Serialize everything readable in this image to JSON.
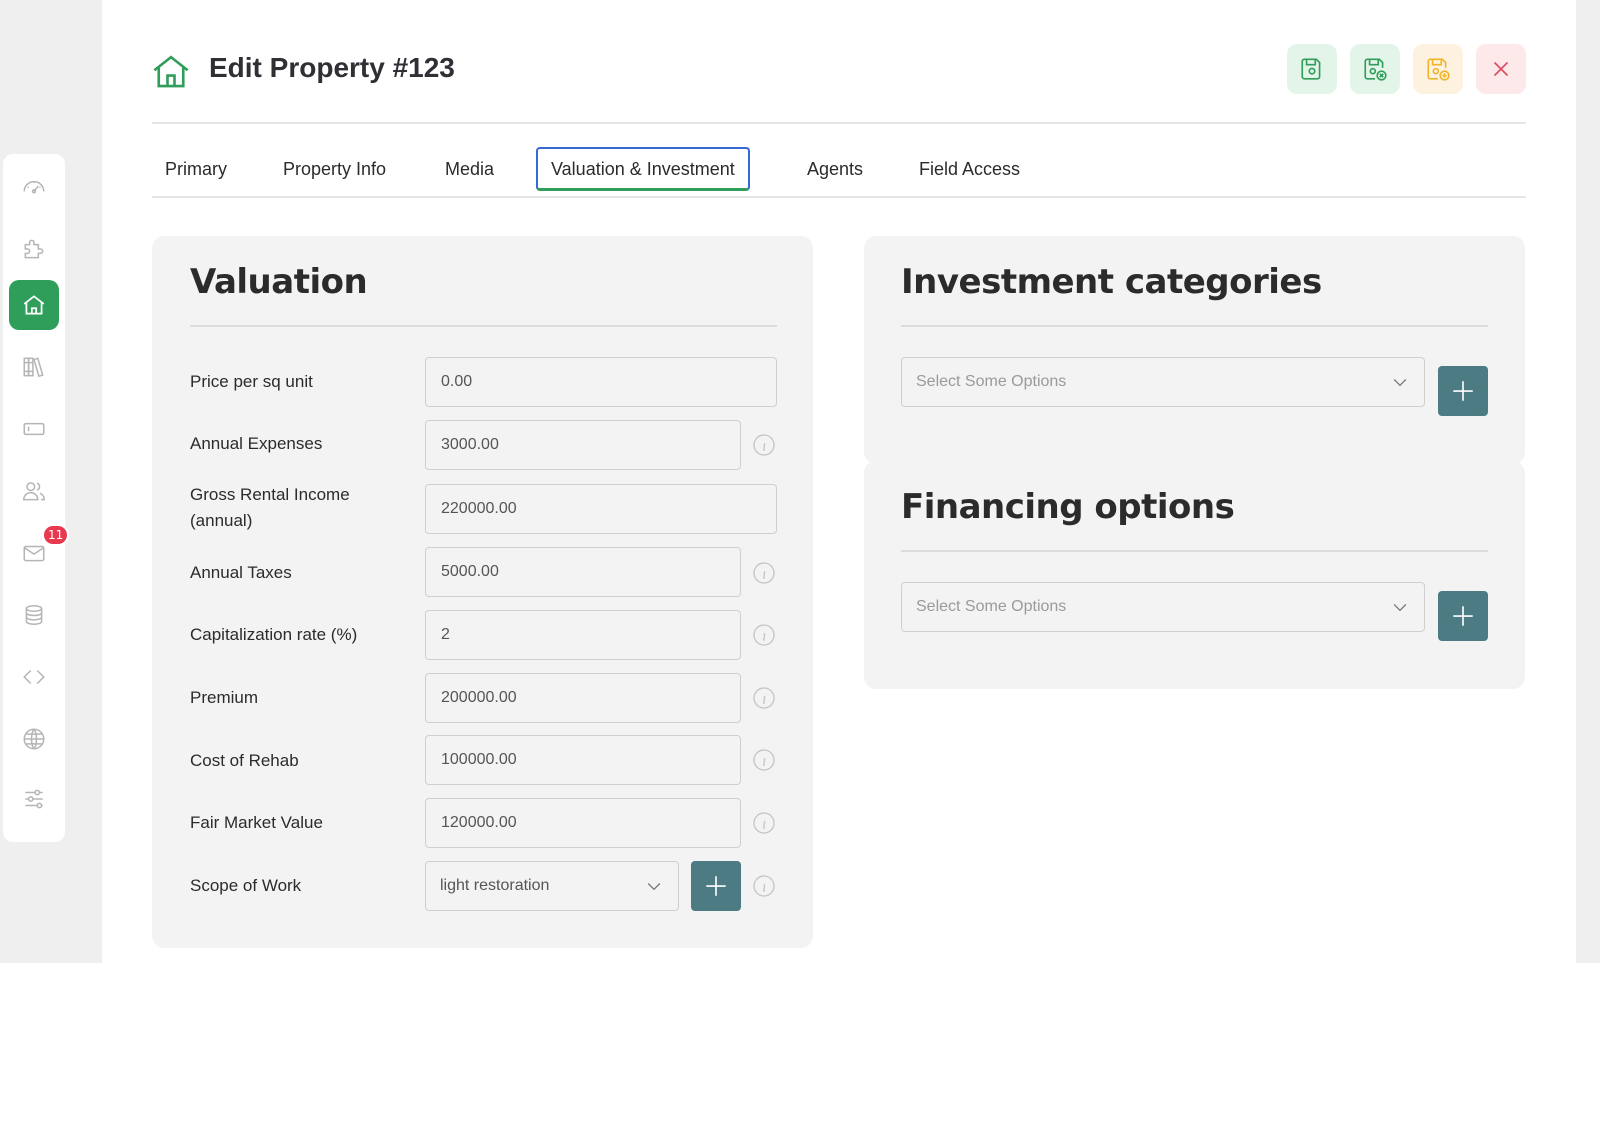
{
  "header": {
    "title": "Edit Property #123",
    "icon": "house-icon",
    "actions": [
      {
        "name": "save",
        "icon": "save-icon",
        "bg": "#e3f4e8",
        "color": "#2f9e5a"
      },
      {
        "name": "save-close",
        "icon": "save-close-icon",
        "bg": "#e3f4e8",
        "color": "#2f9e5a"
      },
      {
        "name": "save-new",
        "icon": "save-new-icon",
        "bg": "#fdf2e0",
        "color": "#f0b429"
      },
      {
        "name": "close",
        "icon": "close-icon",
        "bg": "#fde8ea",
        "color": "#e04a5e"
      }
    ]
  },
  "sidebar": {
    "items": [
      {
        "icon": "dashboard-icon"
      },
      {
        "icon": "puzzle-icon"
      },
      {
        "icon": "home-icon",
        "active": true
      },
      {
        "icon": "library-icon"
      },
      {
        "icon": "ticket-icon"
      },
      {
        "icon": "users-icon"
      },
      {
        "icon": "mail-icon",
        "badge": "11"
      },
      {
        "icon": "database-icon"
      },
      {
        "icon": "code-icon"
      },
      {
        "icon": "globe-icon"
      },
      {
        "icon": "sliders-icon"
      }
    ]
  },
  "tabs": [
    {
      "label": "Primary"
    },
    {
      "label": "Property Info"
    },
    {
      "label": "Media"
    },
    {
      "label": "Valuation & Investment",
      "active": true
    },
    {
      "label": "Agents"
    },
    {
      "label": "Field Access"
    }
  ],
  "valuation": {
    "title": "Valuation",
    "fields": [
      {
        "label": "Price per sq unit",
        "value": "0.00"
      },
      {
        "label": "Annual Expenses",
        "value": "3000.00"
      },
      {
        "label": "Gross Rental Income (annual)",
        "value": "220000.00"
      },
      {
        "label": "Annual Taxes",
        "value": "5000.00"
      },
      {
        "label": "Capitalization rate (%)",
        "value": "2"
      },
      {
        "label": "Premium",
        "value": "200000.00"
      },
      {
        "label": "Cost of Rehab",
        "value": "100000.00"
      },
      {
        "label": "Fair Market Value",
        "value": "120000.00"
      },
      {
        "label": "Scope of Work",
        "value": "light restoration"
      }
    ]
  },
  "investment": {
    "title": "Investment categories",
    "placeholder": "Select Some Options"
  },
  "financing": {
    "title": "Financing options",
    "placeholder": "Select Some Options"
  },
  "colors": {
    "accent": "#2f9e5a",
    "tab_border": "#3569d4",
    "add_button": "#4d7b83",
    "badge": "#e8394f"
  }
}
